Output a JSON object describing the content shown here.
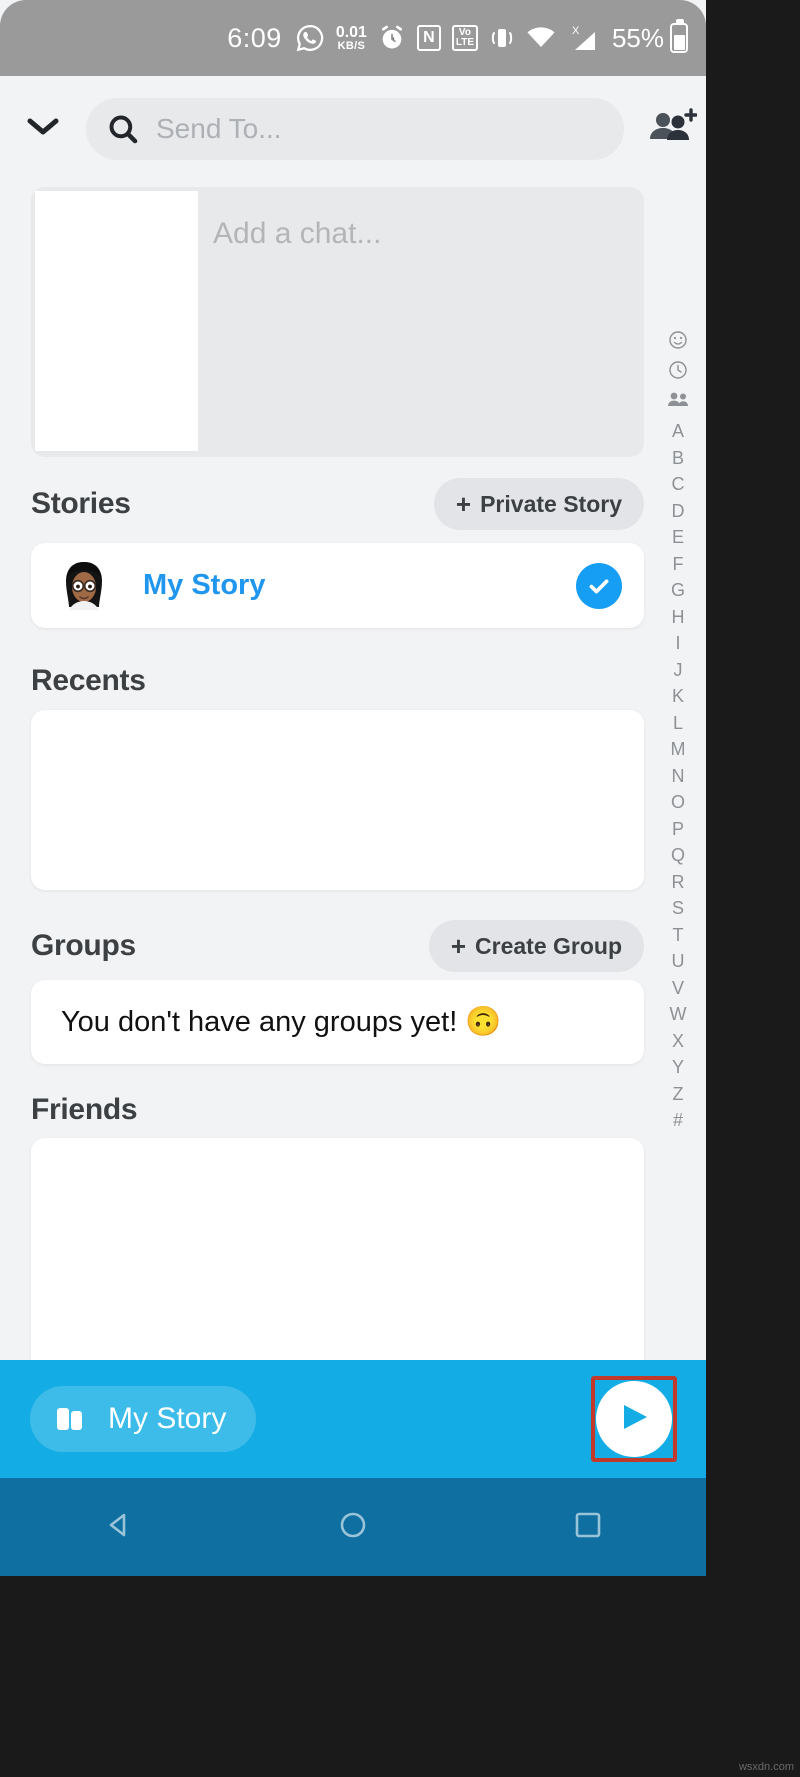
{
  "status_bar": {
    "time": "6:09",
    "whatsapp_icon": "whatsapp-icon",
    "data_rate_value": "0.01",
    "data_rate_unit": "KB/S",
    "alarm_icon": "alarm-icon",
    "nfc_label": "N",
    "volte_line1": "Vo",
    "volte_line2": "LTE",
    "vibrate_icon": "vibrate-icon",
    "wifi_icon": "wifi-icon",
    "signal_icon": "signal-icon",
    "signal_x": "X",
    "battery_percent": "55%"
  },
  "header": {
    "collapse_icon": "chevron-down-icon",
    "search_icon": "search-icon",
    "search_value": "",
    "search_placeholder": "Send To...",
    "add_friends_icon": "add-friends-icon"
  },
  "composer": {
    "add_chat_placeholder": "Add a chat..."
  },
  "sections": {
    "stories": {
      "title": "Stories",
      "action_plus": "+",
      "action_label": "Private Story",
      "items": [
        {
          "name": "My Story",
          "selected": true,
          "avatar": "bitmoji-avatar",
          "check_icon": "check-circle-icon"
        }
      ]
    },
    "recents": {
      "title": "Recents",
      "items": []
    },
    "groups": {
      "title": "Groups",
      "action_plus": "+",
      "action_label": "Create Group",
      "empty_text": "You don't have any groups yet! 🙃"
    },
    "friends": {
      "title": "Friends",
      "items": []
    }
  },
  "index_rail": {
    "icons": [
      "emoji-icon",
      "clock-icon",
      "group-icon"
    ],
    "letters": [
      "A",
      "B",
      "C",
      "D",
      "E",
      "F",
      "G",
      "H",
      "I",
      "J",
      "K",
      "L",
      "M",
      "N",
      "O",
      "P",
      "Q",
      "R",
      "S",
      "T",
      "U",
      "V",
      "W",
      "X",
      "Y",
      "Z",
      "#"
    ]
  },
  "send_bar": {
    "chip_icon": "story-cards-icon",
    "chip_label": "My Story",
    "send_icon": "send-arrow-icon",
    "highlight_color": "#c0392b",
    "bar_color": "#13ace4"
  },
  "nav_bar": {
    "back_icon": "back-triangle-icon",
    "home_icon": "home-circle-icon",
    "recents_icon": "recents-square-icon"
  },
  "watermark": "wsxdn.com"
}
